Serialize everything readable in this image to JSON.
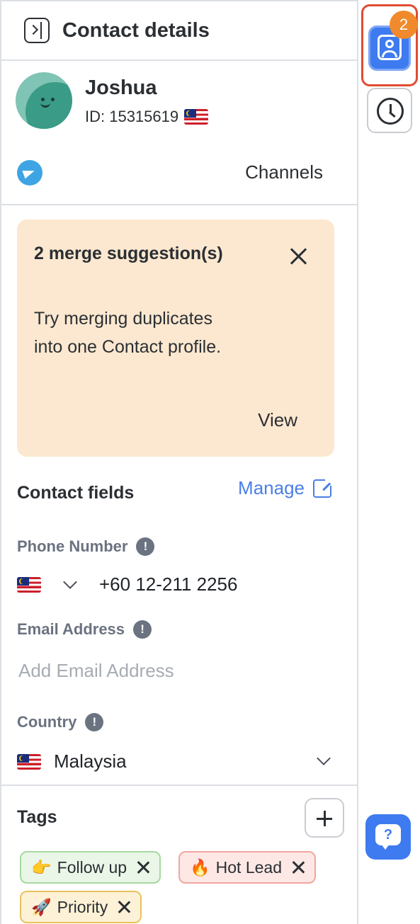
{
  "header": {
    "title": "Contact details"
  },
  "profile": {
    "name": "Joshua",
    "id_text": "ID: 15315619",
    "channels_label": "Channels"
  },
  "merge_card": {
    "title": "2 merge suggestion(s)",
    "body": "Try merging duplicates into one Contact profile.",
    "view_label": "View"
  },
  "contact_fields": {
    "title": "Contact fields",
    "manage_label": "Manage",
    "phone": {
      "label": "Phone Number",
      "value": "+60 12-211 2256"
    },
    "email": {
      "label": "Email Address",
      "placeholder": "Add Email Address"
    },
    "country": {
      "label": "Country",
      "value": "Malaysia"
    }
  },
  "tags": {
    "title": "Tags",
    "items": [
      {
        "emoji": "👉",
        "label": "Follow up",
        "bg": "#eaf6e8",
        "border": "#a6d8a0"
      },
      {
        "emoji": "🔥",
        "label": "Hot Lead",
        "bg": "#fde8e6",
        "border": "#f0a6a0"
      },
      {
        "emoji": "🚀",
        "label": "Priority",
        "bg": "#fdf2d7",
        "border": "#e8c25e"
      }
    ]
  },
  "rail": {
    "badge_count": "2",
    "help_glyph": "?"
  },
  "colors": {
    "accent": "#3e7bf0",
    "link": "#4a7fe6",
    "merge_bg": "#fce8d0",
    "badge": "#f08a2c",
    "highlight": "#e04b34"
  }
}
